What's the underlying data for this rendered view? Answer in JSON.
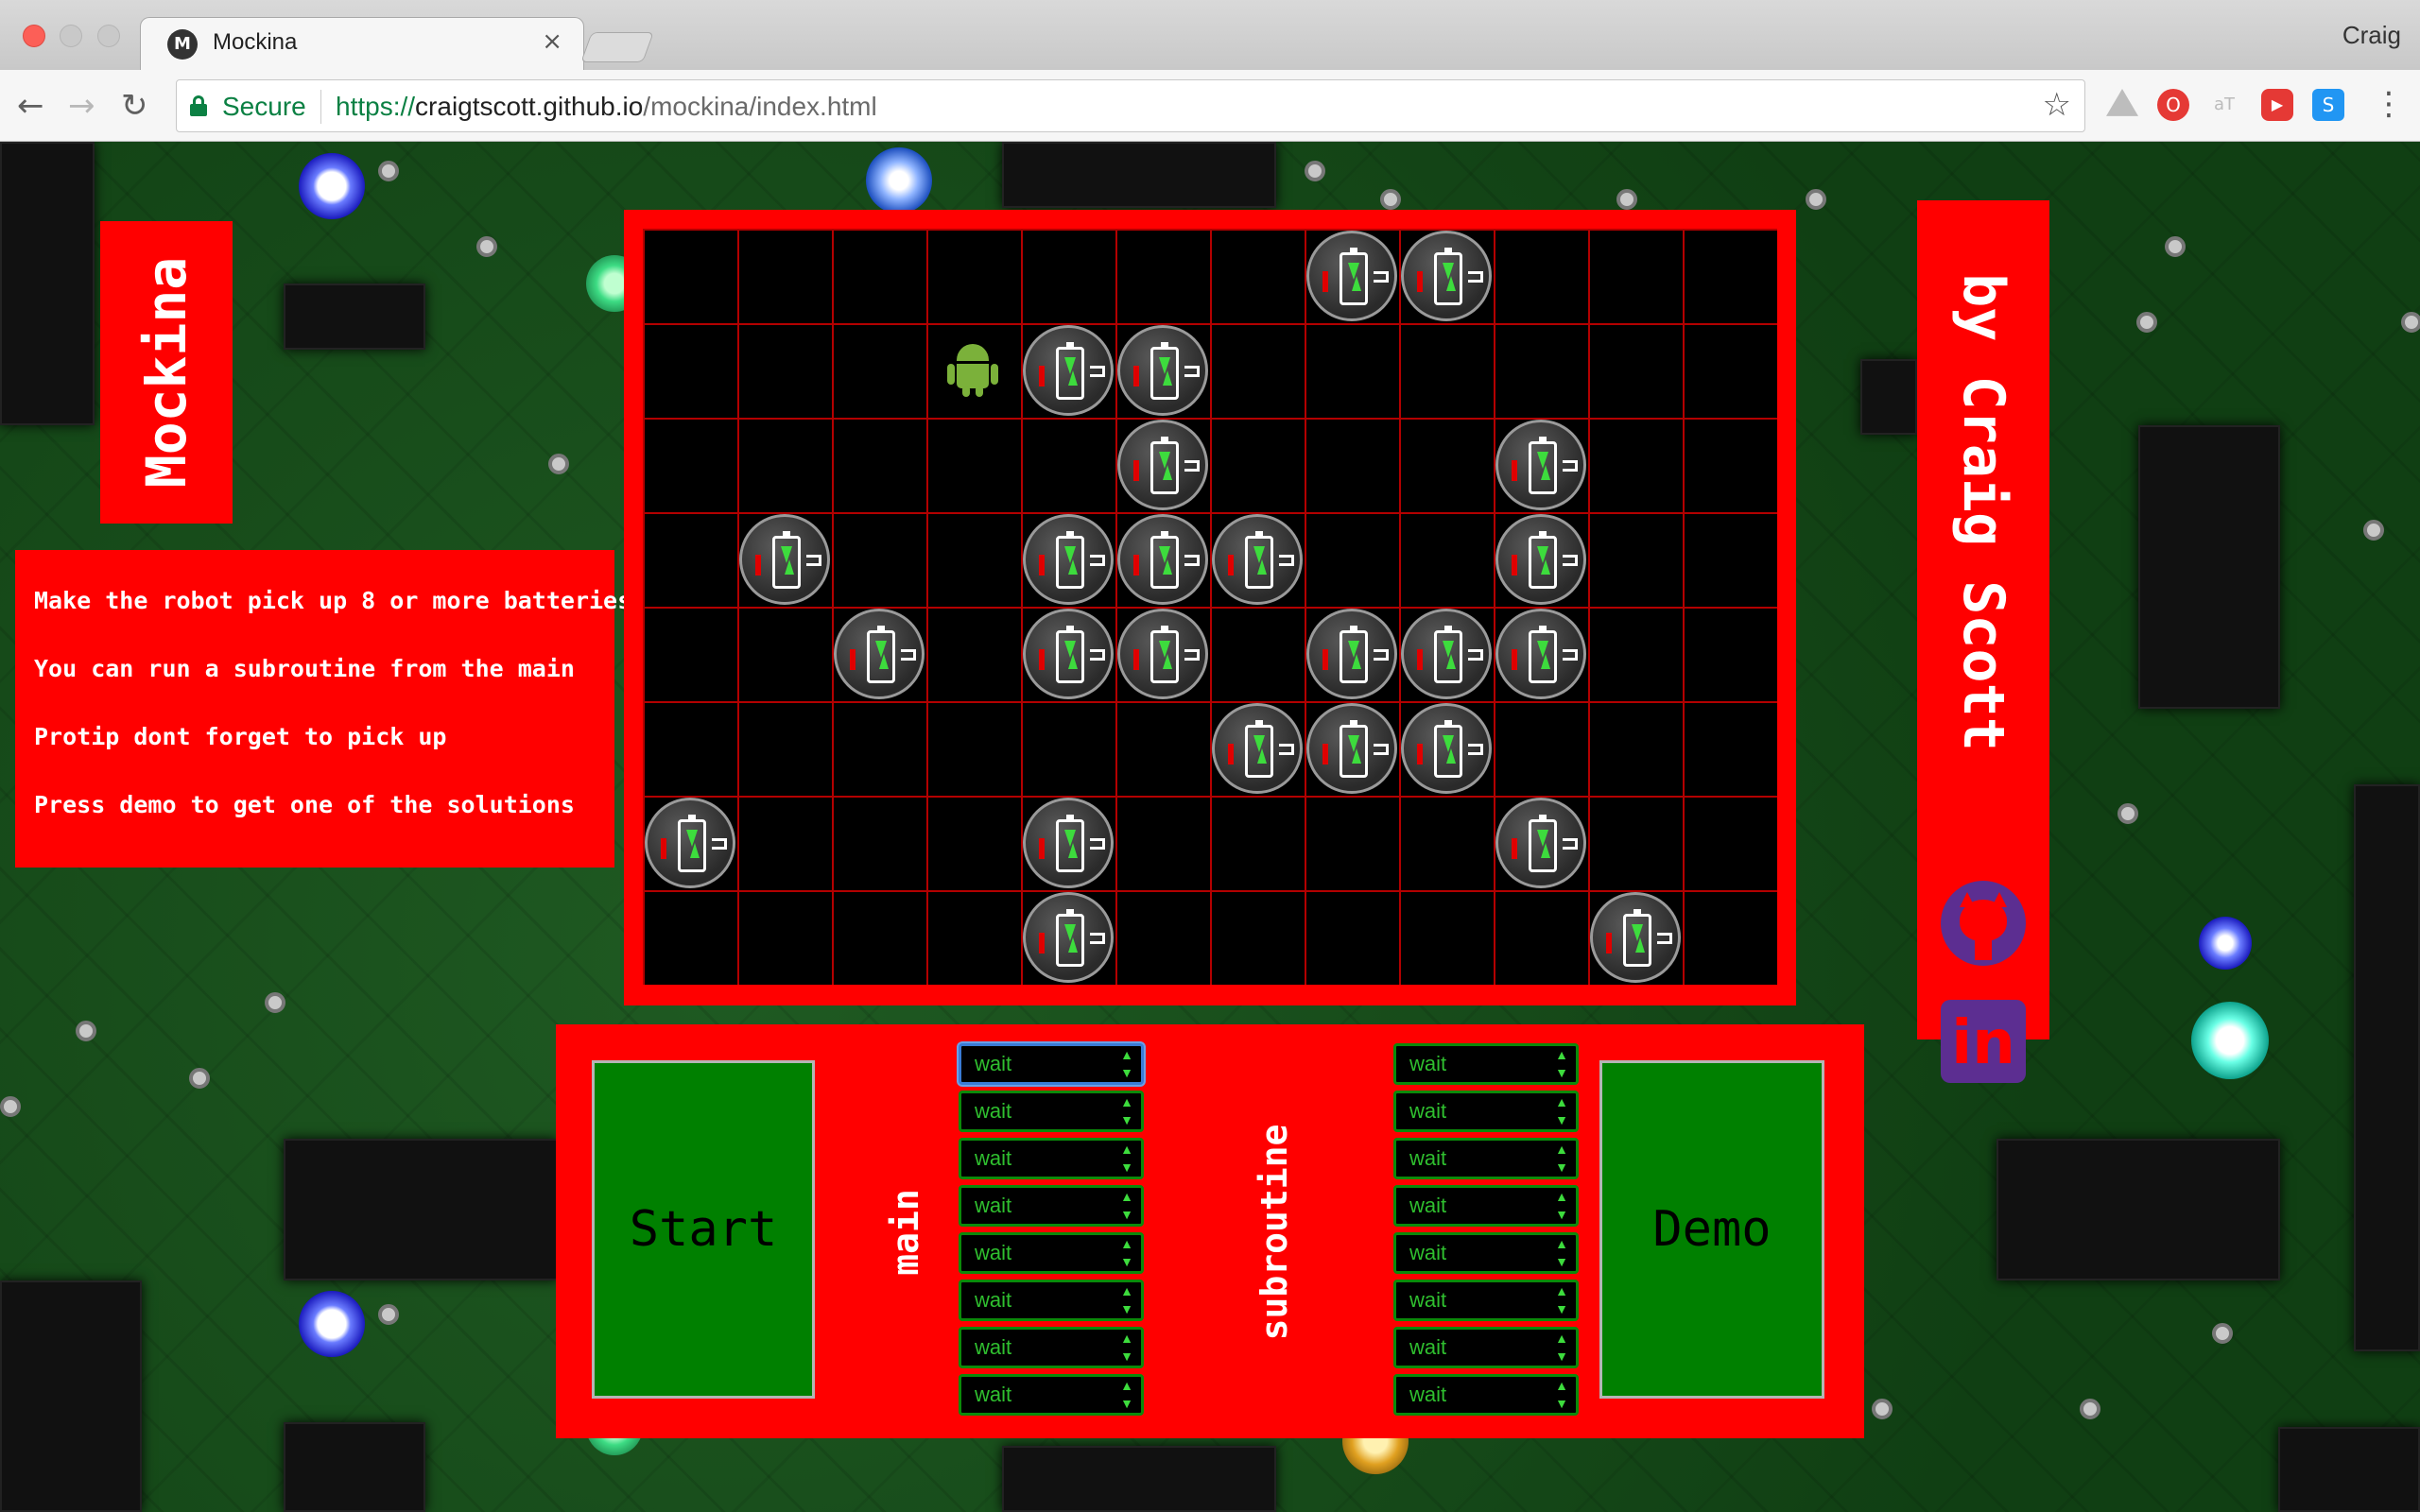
{
  "browser": {
    "tab_title": "Mockina",
    "tab_favicon": "M",
    "tab_close": "×",
    "profile_name": "Craig",
    "secure_label": "Secure",
    "url_scheme": "https://",
    "url_host": "craigtscott.github.io",
    "url_path": "/mockina/index.html",
    "icons": [
      "back-arrow-icon",
      "forward-arrow-icon",
      "reload-icon",
      "lock-icon",
      "star-icon",
      "google-drive-icon",
      "opera-icon",
      "at-icon",
      "youtube-icon",
      "stylus-icon",
      "menu-icon"
    ]
  },
  "app": {
    "title": "Mockina",
    "author": "by Craig Scott",
    "instructions": [
      "Make the robot pick up 8 or more batteries",
      "You can run a subroutine from the main",
      "Protip dont forget to pick up",
      "Press demo to get one of the solutions"
    ],
    "links": [
      "github-icon",
      "linkedin-icon"
    ]
  },
  "board": {
    "columns": 12,
    "rows": 8,
    "robot": {
      "col": 3,
      "row": 1
    },
    "batteries": [
      {
        "col": 7,
        "row": 0
      },
      {
        "col": 8,
        "row": 0
      },
      {
        "col": 4,
        "row": 1
      },
      {
        "col": 5,
        "row": 1
      },
      {
        "col": 5,
        "row": 2
      },
      {
        "col": 9,
        "row": 2
      },
      {
        "col": 1,
        "row": 3
      },
      {
        "col": 4,
        "row": 3
      },
      {
        "col": 5,
        "row": 3
      },
      {
        "col": 6,
        "row": 3
      },
      {
        "col": 9,
        "row": 3
      },
      {
        "col": 2,
        "row": 4
      },
      {
        "col": 4,
        "row": 4
      },
      {
        "col": 5,
        "row": 4
      },
      {
        "col": 7,
        "row": 4
      },
      {
        "col": 8,
        "row": 4
      },
      {
        "col": 9,
        "row": 4
      },
      {
        "col": 6,
        "row": 5
      },
      {
        "col": 7,
        "row": 5
      },
      {
        "col": 8,
        "row": 5
      },
      {
        "col": 0,
        "row": 6
      },
      {
        "col": 4,
        "row": 6
      },
      {
        "col": 9,
        "row": 6
      },
      {
        "col": 4,
        "row": 7
      },
      {
        "col": 10,
        "row": 7
      }
    ]
  },
  "controls": {
    "start_label": "Start",
    "demo_label": "Demo",
    "main_label": "main",
    "subroutine_label": "subroutine",
    "main_commands": [
      "wait",
      "wait",
      "wait",
      "wait",
      "wait",
      "wait",
      "wait",
      "wait"
    ],
    "subroutine_commands": [
      "wait",
      "wait",
      "wait",
      "wait",
      "wait",
      "wait",
      "wait",
      "wait"
    ]
  },
  "colors": {
    "panel": "#ff0000",
    "board_bg": "#000000",
    "grid": "#b30000",
    "button": "#008000",
    "command_text": "#2fbf2f",
    "robot": "#7bb13a",
    "icon_bg": "#5c2e91"
  }
}
